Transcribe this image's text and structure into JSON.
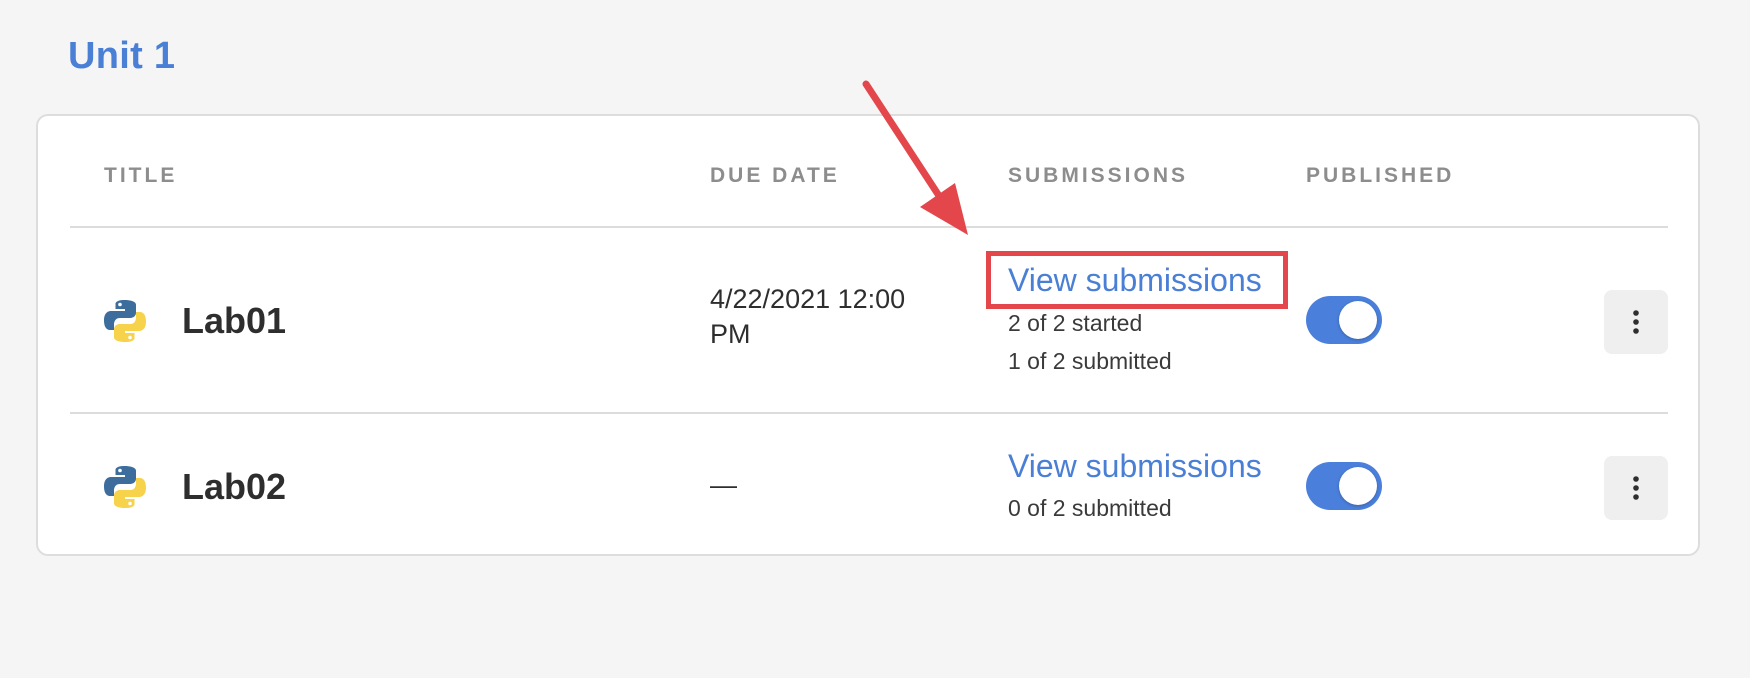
{
  "unit": {
    "title": "Unit 1"
  },
  "table": {
    "headers": {
      "title": "TITLE",
      "due_date": "DUE DATE",
      "submissions": "SUBMISSIONS",
      "published": "PUBLISHED"
    },
    "rows": [
      {
        "name": "Lab01",
        "icon": "python-icon",
        "due_line1": "4/22/2021 12:00",
        "due_line2": "PM",
        "view_label": "View submissions",
        "started": "2 of 2 started",
        "submitted": "1 of 2 submitted",
        "published": true
      },
      {
        "name": "Lab02",
        "icon": "python-icon",
        "due_line1": "—",
        "view_label": "View submissions",
        "submitted": "0 of 2 submitted",
        "published": true
      }
    ]
  },
  "colors": {
    "accent": "#4a7fd6",
    "toggle_on": "#4a80dc",
    "annotation": "#e3474c",
    "python_blue": "#3c6d9d",
    "python_yellow": "#f6d34a"
  },
  "annotation": {
    "arrow": "red-arrow-icon",
    "highlight": "red-highlight-box"
  }
}
